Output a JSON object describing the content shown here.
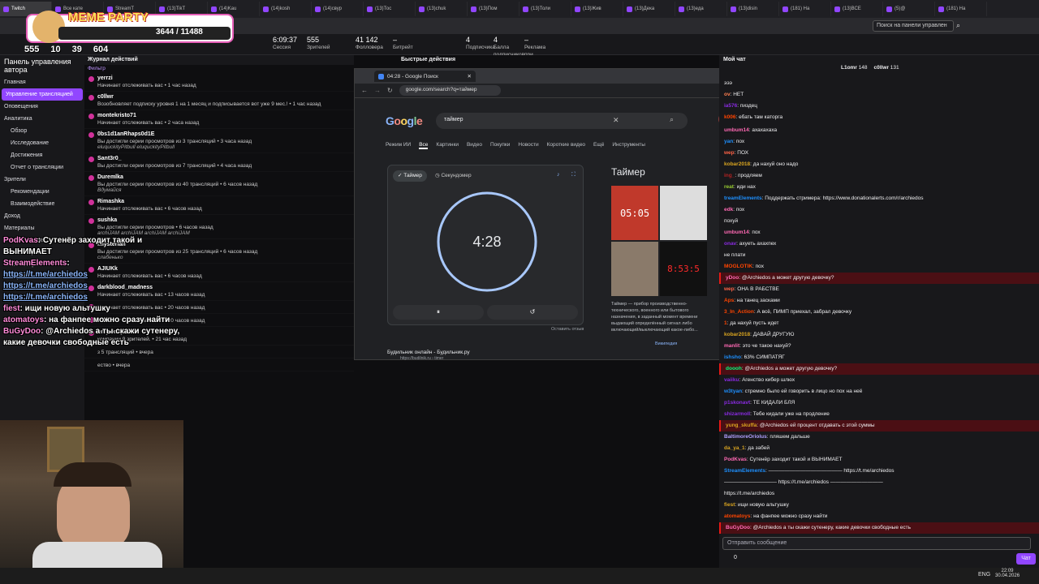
{
  "browser_tabs": [
    "Twitch",
    "Все кате",
    "StreamT",
    "(13)TikT",
    "(14)Kau",
    "(14)kosh",
    "(14)свур",
    "(13)Тос",
    "(13)chuk",
    "(13)Пом",
    "(13)Толи",
    "(13)Жив",
    "(13)Дека",
    "(13)еда",
    "(13)disin",
    "(181) На",
    "(13)ВСЕ",
    "(5)@",
    "(181) На"
  ],
  "overlay": {
    "banner": "MEME PARTY",
    "progress": "3644 / 11488",
    "stat_subs": "555",
    "stat_b": "10",
    "stat_c": "39",
    "stat_d": "604"
  },
  "stats": [
    {
      "n": "6:09:37",
      "l": "Сессия"
    },
    {
      "n": "555",
      "l": "Зрителей"
    },
    {
      "n": "41 142",
      "l": "Фолловера"
    },
    {
      "n": "–",
      "l": "Битрейт"
    },
    {
      "n": "4",
      "l": "Подписчика"
    },
    {
      "n": "4",
      "l": "Балла подписчиков"
    },
    {
      "n": "–",
      "l": "Реклама при запуске вкл."
    }
  ],
  "search_placeholder": "Поиск на панели управлен",
  "leftnav": {
    "title": "Панель управления автора",
    "items": [
      "Главная",
      "Управление трансляцией",
      "Оповещения",
      "Аналитика",
      "Обзор",
      "Исследование",
      "Достижения",
      "Отчет о трансляции",
      "Зрители",
      "Рекомендации",
      "Взаимодействие",
      "Доход",
      "Материалы",
      "Видеостудия",
      "Коллекции",
      "Монетизация",
      "Настройки"
    ]
  },
  "activity": {
    "header": "Журнал действий",
    "filter": "Фильтр",
    "rows": [
      {
        "u": "yerrzi",
        "t": "Начинает отслеживать вас • 1 час назад"
      },
      {
        "u": "c0llwr",
        "t": "Возобновляет подписку уровня 1 на 1 месяц и подписывается вот уже 9 мес.! • 1 час назад"
      },
      {
        "u": "montekristo71",
        "t": "Начинает отслеживать вас • 2 часа назад"
      },
      {
        "u": "0bs1d1anRhaps0d1E",
        "t": "Вы достигли серии просмотров из 3 трансляций • 3 часа назад",
        "it": "eluquckityPitbull eluquckityPitbull"
      },
      {
        "u": "Sant3r0_",
        "t": "Вы достигли серии просмотров из 7 трансляций • 4 часа назад"
      },
      {
        "u": "Duremlka",
        "t": "Вы достигли серии просмотров из 40 трансляций • 6 часов назад",
        "it": "Вдумайся"
      },
      {
        "u": "Rimashka",
        "t": "Начинает отслеживать вас • 6 часов назад"
      },
      {
        "u": "sushka",
        "t": "Вы достигли серии просмотров • 6 часов назад",
        "it": "archiJAM archiJAM archiJAM archiJAM"
      },
      {
        "u": "iMysterian",
        "t": "Вы достигли серии просмотров из 25 трансляций • 6 часов назад",
        "it": "слабенько"
      },
      {
        "u": "AJIUKk",
        "t": "Начинает отслеживать вас • 6 часов назад"
      },
      {
        "u": "darkblood_madness",
        "t": "Начинает отслеживать вас • 13 часов назад"
      },
      {
        "u": "",
        "t": "Начинает отслеживать вас • 20 часов назад"
      },
      {
        "u": "",
        "t": "Начинает отслеживать вас • 20 часов назад"
      },
      {
        "u": "only_katya",
        "t": "компании 9 зрителей. • 21 час назад"
      }
    ],
    "tail": [
      "з 5 трансляций • вчера",
      "ество • вчера"
    ]
  },
  "quick_header": "Быстрые действия",
  "google": {
    "tab_title": "04:28 - Google Поиск",
    "url": "google.com/search?q=таймер",
    "query": "таймер",
    "filters": [
      "Режим ИИ",
      "Все",
      "Картинки",
      "Видео",
      "Покупки",
      "Новости",
      "Короткие видео",
      "Ещё",
      "Инструменты"
    ],
    "timer_tab": "Таймер",
    "stopwatch_tab": "Секундомер",
    "time": "4:28",
    "feedback": "Оставить отзыв",
    "kp_title": "Таймер",
    "kp_text": "Таймер — прибор производственно-технического, военного или бытового назначения, в заданный момент времени выдающий определённый сигнал либо включающий/выключающий какое-либо...",
    "kp_source": "Википедия",
    "result_title": "Будильник онлайн - Будильник.ру",
    "result_url": "https://budilnik.ru › timer"
  },
  "chat": {
    "header": "Мой чат",
    "input_placeholder": "Отправить сообщение",
    "send": "Чат",
    "points": "0",
    "top_users": [
      {
        "u": "L1omr",
        "v": "148"
      },
      {
        "u": "c0llwr",
        "v": "131"
      }
    ],
    "lines": [
      {
        "n": "",
        "c": "#e91916",
        "m": "эээ",
        "hl": false
      },
      {
        "n": "ov",
        "c": "#ff7f50",
        "m": "НЕТ",
        "hl": false
      },
      {
        "n": "ia576",
        "c": "#8a2be2",
        "m": "пиздец",
        "hl": false
      },
      {
        "n": "k006",
        "c": "#ff4500",
        "m": "ебать там каторга",
        "hl": false
      },
      {
        "n": "",
        "c": "#ddd",
        "m": "",
        "hl": false
      },
      {
        "n": "umbum14",
        "c": "#ff69b4",
        "m": "ахахахаха",
        "hl": false
      },
      {
        "n": "yan",
        "c": "#1e90ff",
        "m": "пох",
        "hl": false
      },
      {
        "n": "wep",
        "c": "#ff6347",
        "m": "ПОХ",
        "hl": false
      },
      {
        "n": "kobar2018",
        "c": "#daa520",
        "m": "да нахуй оно надо",
        "hl": false
      },
      {
        "n": "ing_",
        "c": "#b22222",
        "m": "продляем",
        "hl": false
      },
      {
        "n": "reat",
        "c": "#9acd32",
        "m": "иди нах",
        "hl": false
      },
      {
        "n": "treamElements",
        "c": "#1e90ff",
        "m": "Поддержать стримера: https://www.donationalerts.com/r/archiedos",
        "hl": false
      },
      {
        "n": "edk",
        "c": "#ff69b4",
        "m": "пох",
        "hl": false
      },
      {
        "n": "",
        "c": "#ddd",
        "m": "похуй",
        "hl": false
      },
      {
        "n": "umbum14",
        "c": "#ff69b4",
        "m": "пох",
        "hl": false
      },
      {
        "n": "onav",
        "c": "#8a2be2",
        "m": "ахуеть ахахпех",
        "hl": false
      },
      {
        "n": "",
        "c": "#ddd",
        "m": "не плати",
        "hl": false
      },
      {
        "n": "MOGLOTIK",
        "c": "#ff4500",
        "m": "пох",
        "hl": false
      },
      {
        "n": "yDoo",
        "c": "#ff69b4",
        "m": "@Archiedos а может другую девочку?",
        "hl": true
      },
      {
        "n": "wep",
        "c": "#ff6347",
        "m": "ОНА В РАБСТВЕ",
        "hl": false
      },
      {
        "n": "Aps",
        "c": "#ff4500",
        "m": "на танец засками",
        "hl": false
      },
      {
        "n": "3_In_Action",
        "c": "#ff4500",
        "m": "А всё, ПИМП приехал, забрал девочку",
        "hl": false
      },
      {
        "n": "1",
        "c": "#ff4500",
        "m": "да нахуй пусть идет",
        "hl": false
      },
      {
        "n": "kobar2018",
        "c": "#daa520",
        "m": "ДАВАЙ ДРУГУЮ",
        "hl": false
      },
      {
        "n": "manlit",
        "c": "#ff69b4",
        "m": "это че такое нахуй?",
        "hl": false
      },
      {
        "n": "ishsho",
        "c": "#1e90ff",
        "m": "63% СИМПАТЯГ",
        "hl": false
      },
      {
        "n": "doooh",
        "c": "#00ff7f",
        "m": "@Archiedos а может другую девочку?",
        "hl": true
      },
      {
        "n": "vaiiku",
        "c": "#8a2be2",
        "m": "Агенство кибер шлюх",
        "hl": false
      },
      {
        "n": "w3tyan",
        "c": "#1e90ff",
        "m": "стремно было ей говорить в лицо но пох на неё",
        "hl": false
      },
      {
        "n": "p1skonavt",
        "c": "#8a2be2",
        "m": "ТЕ КИДАЛИ БЛЯ",
        "hl": false
      },
      {
        "n": "shizarmoll",
        "c": "#8a2be2",
        "m": "Тебе кидали уже на продление",
        "hl": false
      },
      {
        "n": "yung_skuffa",
        "c": "#daa520",
        "m": "@Archiedos ей процент отдавать с этой суммы",
        "hl": true
      },
      {
        "n": "BaltimoreOriolus",
        "c": "#b0a0ff",
        "m": "пляшем дальше",
        "hl": false
      },
      {
        "n": "da_ya_1",
        "c": "#daa520",
        "m": "да забей",
        "hl": false
      },
      {
        "n": "PodKvas",
        "c": "#ff69b4",
        "m": "Сутенёр заходит такой и ВЫНИМАЕТ",
        "hl": false
      },
      {
        "n": "StreamElements",
        "c": "#1e90ff",
        "m": "—————————————— https://t.me/archiedos",
        "hl": false
      },
      {
        "n": "",
        "c": "#ddd",
        "m": "—————————— https://t.me/archiedos ——————————",
        "hl": false
      },
      {
        "n": "",
        "c": "#ddd",
        "m": "https://t.me/archiedos",
        "hl": false
      },
      {
        "n": "fiest",
        "c": "#daa520",
        "m": "ищи новую альтушку",
        "hl": false
      },
      {
        "n": "atomatoys",
        "c": "#ff4500",
        "m": "на фанпее можно сразу найти",
        "hl": false
      },
      {
        "n": "BuGyDoo",
        "c": "#ff69b4",
        "m": "@Archiedos а ты скажи сутенеру, какие девочки свободные есть",
        "hl": true
      }
    ]
  },
  "overlay_chat": [
    {
      "n": "PodKvas",
      "m": "Сутенёр заходит такой и ВЫНИМАЕТ"
    },
    {
      "n": "StreamElements",
      "m": ""
    },
    {
      "n": "",
      "m": "https://t.me/archiedos"
    },
    {
      "n": "",
      "m": "https://t.me/archiedos"
    },
    {
      "n": "",
      "m": "https://t.me/archiedos"
    },
    {
      "n": "fiest",
      "m": "ищи новую альтушку"
    },
    {
      "n": "atomatoys",
      "m": "на фанпее можно сразу найти"
    },
    {
      "n": "BuGyDoo",
      "m": "@Archiedos а ты скажи сутенеру, какие девочки свободные есть"
    }
  ],
  "taskbar": {
    "lang": "ENG",
    "time": "22:09",
    "date": "30.04.2026"
  }
}
